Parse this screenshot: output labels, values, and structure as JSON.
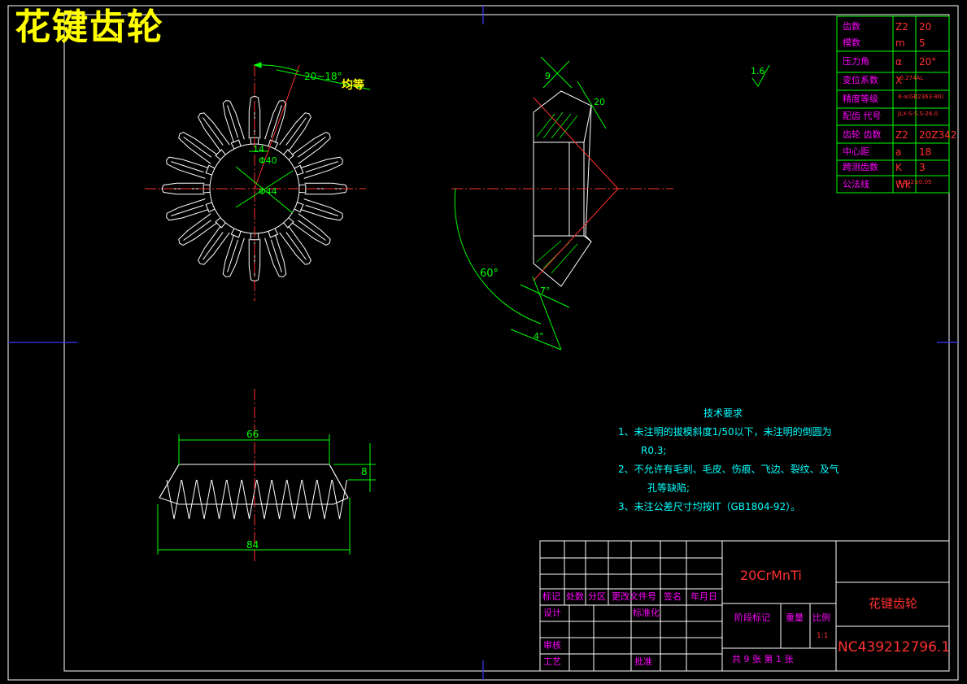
{
  "drawing": {
    "title": "花键齿轮",
    "material": "20CrMnTi",
    "part_name": "花键齿轮",
    "drawing_number": "NC439212796.1",
    "roughness": "1.6"
  },
  "dimensions": {
    "angle_top": "20~18°",
    "angle_top_suffix": "均等",
    "bore_a": "Φ40",
    "bore_b": "Φ44",
    "hub_width": "14",
    "side_9": "9",
    "side_20": "20",
    "angle_60": "60°",
    "angle_7": "7°",
    "angle_4": "4°",
    "bottom_66": "66",
    "bottom_84": "84",
    "bottom_8": "8"
  },
  "params_table": {
    "rows": [
      {
        "label": "齿数",
        "sym": "Z2",
        "val": "20"
      },
      {
        "label": "模数",
        "sym": "m",
        "val": "5"
      },
      {
        "label": "压力角",
        "sym": "α",
        "val": "20°"
      },
      {
        "label": "变位系数",
        "sym": "X",
        "val": "-0.274AL"
      },
      {
        "label": "精度等级",
        "sym": "",
        "val": "8-a(GB2363-80)"
      },
      {
        "label": "配齿 代号",
        "sym": "",
        "val": "JLX-S-S.S-26.0"
      },
      {
        "label": "齿轮 齿数",
        "sym": "Z2",
        "val": "20Z342"
      },
      {
        "label": "中心距",
        "sym": "a",
        "val": "18"
      },
      {
        "label": "跨测齿数",
        "sym": "K",
        "val": "3"
      },
      {
        "label": "公法线",
        "sym": "Wk",
        "val": "6.822±0.05"
      }
    ]
  },
  "tech_notes": {
    "title": "技术要求",
    "line1": "1、未注明的拔模斜度1/50以下，未注明的倒圆为",
    "line1b": "R0.3;",
    "line2": "2、不允许有毛刺、毛皮、伤痕、飞边、裂纹、及气",
    "line2b": "孔等缺陷;",
    "line3": "3、未注公差尺寸均按IT（GB1804-92）。"
  },
  "title_block": {
    "mark": "标记",
    "count": "处数",
    "zone": "分区",
    "change_doc": "更改文件号",
    "sign": "签名",
    "date": "年月日",
    "design": "设计",
    "standard": "标准化",
    "stage_mark": "阶段标记",
    "weight": "重量",
    "scale": "比例",
    "scale_val": "1:1",
    "check": "审核",
    "process": "工艺",
    "approve": "批准",
    "sheets": "共 9 张  第 1 张"
  }
}
